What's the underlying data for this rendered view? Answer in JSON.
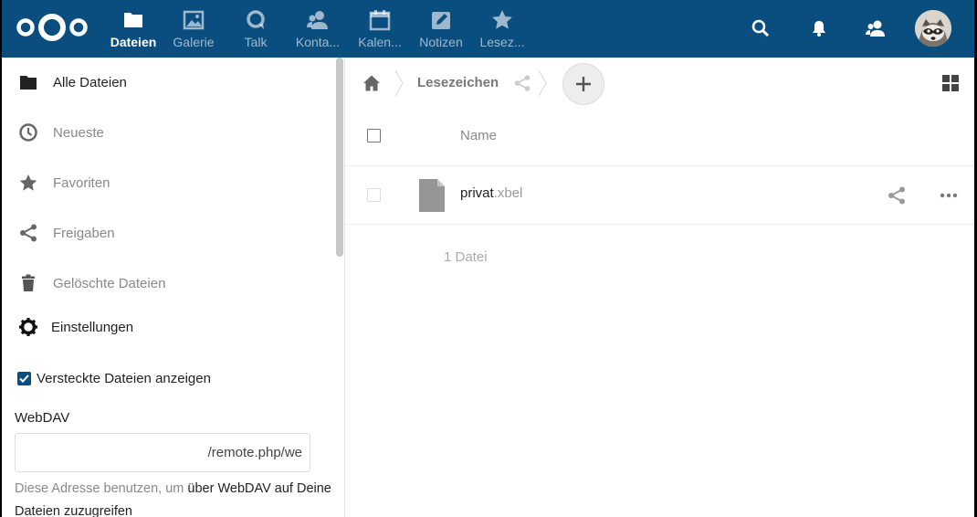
{
  "header": {
    "apps": [
      {
        "label": "Dateien",
        "icon": "folder-icon",
        "active": true
      },
      {
        "label": "Galerie",
        "icon": "image-icon",
        "active": false
      },
      {
        "label": "Talk",
        "icon": "talk-icon",
        "active": false
      },
      {
        "label": "Konta...",
        "icon": "contacts-icon",
        "active": false
      },
      {
        "label": "Kalen...",
        "icon": "calendar-icon",
        "active": false
      },
      {
        "label": "Notizen",
        "icon": "notes-icon",
        "active": false
      },
      {
        "label": "Lesez...",
        "icon": "star-icon",
        "active": false
      }
    ],
    "right_icons": [
      "search-icon",
      "bell-icon",
      "contacts-menu-icon",
      "avatar"
    ],
    "brand_color": "#0a4e80"
  },
  "sidebar": {
    "items": [
      {
        "label": "Alle Dateien",
        "icon": "folder-icon",
        "active": true
      },
      {
        "label": "Neueste",
        "icon": "clock-icon",
        "active": false
      },
      {
        "label": "Favoriten",
        "icon": "star-icon",
        "active": false
      },
      {
        "label": "Freigaben",
        "icon": "share-icon",
        "active": false
      },
      {
        "label": "Gelöschte Dateien",
        "icon": "trash-icon",
        "active": false
      }
    ],
    "settings_label": "Einstellungen",
    "show_hidden_label": "Versteckte Dateien anzeigen",
    "show_hidden_checked": true,
    "webdav_label": "WebDAV",
    "webdav_value": "/remote.php/we",
    "webdav_hint_prefix": "Diese Adresse benutzen, um ",
    "webdav_hint_link": "über WebDAV auf Deine Dateien zuzugreifen"
  },
  "content": {
    "breadcrumb": "Lesezeichen",
    "column_name": "Name",
    "files": [
      {
        "basename": "privat",
        "extension": ".xbel"
      }
    ],
    "summary": "1 Datei"
  }
}
